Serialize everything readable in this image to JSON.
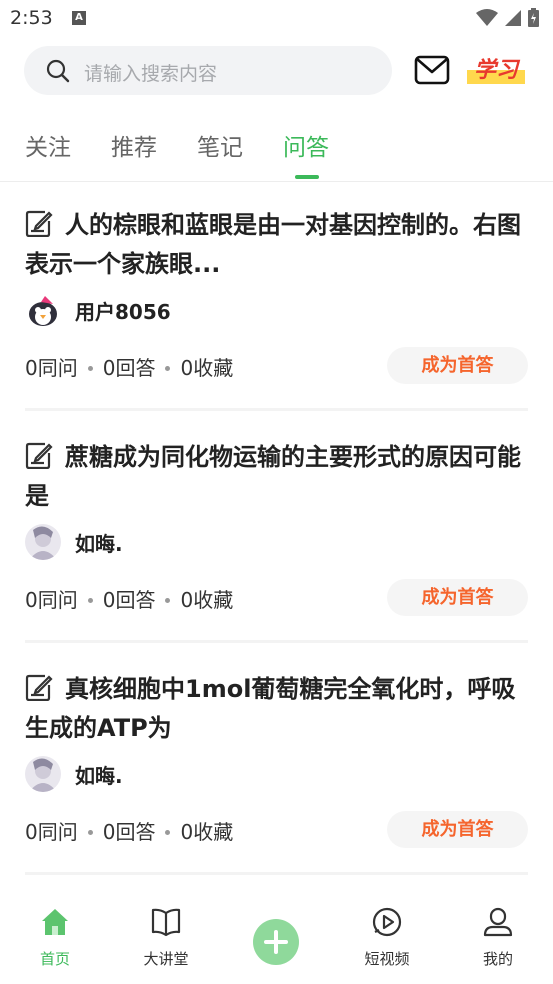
{
  "status_bar": {
    "time": "2:53",
    "notification_icon": "A",
    "icons": [
      "wifi-icon",
      "signal-icon",
      "battery-icon"
    ]
  },
  "header": {
    "search_placeholder": "请输入搜索内容",
    "mail_icon": "mail-icon",
    "logo_text": "学习"
  },
  "tabs": [
    {
      "label": "关注",
      "active": false
    },
    {
      "label": "推荐",
      "active": false
    },
    {
      "label": "笔记",
      "active": false
    },
    {
      "label": "问答",
      "active": true
    }
  ],
  "questions": [
    {
      "title": "人的棕眼和蓝眼是由一对基因控制的。右图表示一个家族眼...",
      "user": "用户8056",
      "stats": [
        "0同问",
        "0回答",
        "0收藏"
      ],
      "action": "成为首答"
    },
    {
      "title": "蔗糖成为同化物运输的主要形式的原因可能是",
      "user": "如晦.",
      "stats": [
        "0同问",
        "0回答",
        "0收藏"
      ],
      "action": "成为首答"
    },
    {
      "title": "真核细胞中1mol葡萄糖完全氧化时，呼吸生成的ATP为",
      "user": "如晦.",
      "stats": [
        "0同问",
        "0回答",
        "0收藏"
      ],
      "action": "成为首答"
    }
  ],
  "bottom_nav": [
    {
      "label": "首页",
      "icon": "home-icon",
      "active": true
    },
    {
      "label": "大讲堂",
      "icon": "book-icon",
      "active": false
    },
    {
      "label": "",
      "icon": "plus-icon",
      "active": false
    },
    {
      "label": "短视频",
      "icon": "video-play-icon",
      "active": false
    },
    {
      "label": "我的",
      "icon": "user-icon",
      "active": false
    }
  ],
  "colors": {
    "accent": "#3cb95a",
    "action": "#f5652d"
  }
}
